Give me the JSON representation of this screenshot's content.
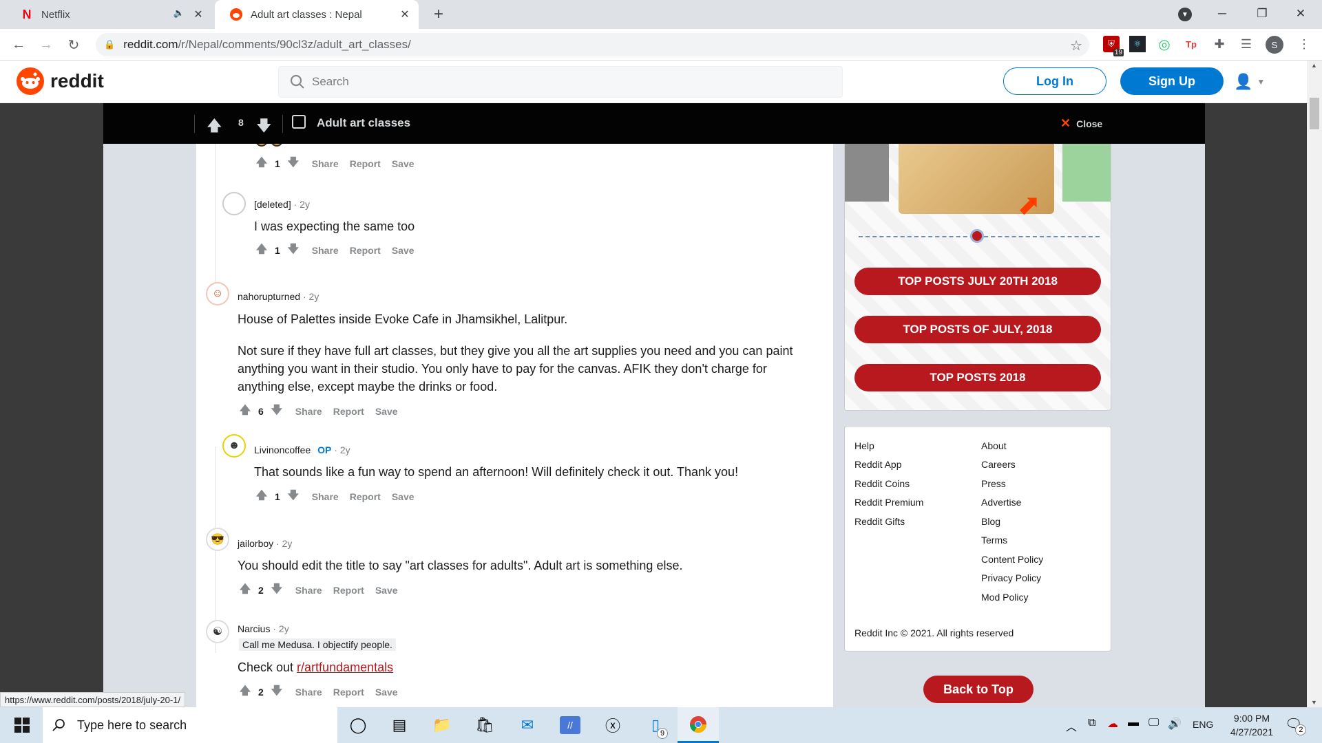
{
  "browser": {
    "tabs": [
      {
        "title": "Netflix",
        "audio_icon": "speaker-icon"
      },
      {
        "title": "Adult art classes : Nepal",
        "active": true
      }
    ],
    "url_domain": "reddit.com",
    "url_path": "/r/Nepal/comments/90cl3z/adult_art_classes/",
    "extension_badge": "19",
    "profile_initial": "S"
  },
  "reddit": {
    "brand": "reddit",
    "search_placeholder": "Search",
    "login_label": "Log In",
    "signup_label": "Sign Up",
    "accent": "#0079d3"
  },
  "postbar": {
    "votes": "8",
    "title": "Adult art classes",
    "close_label": "Close"
  },
  "comments": [
    {
      "score": "1",
      "actions": [
        "Share",
        "Report",
        "Save"
      ]
    },
    {
      "author": "[deleted]",
      "age": "2y",
      "body": "I was expecting the same too",
      "score": "1"
    },
    {
      "author": "nahorupturned",
      "age": "2y",
      "body": [
        "House of Palettes inside Evoke Cafe in Jhamsikhel, Lalitpur.",
        "Not sure if they have full art classes, but they give you all the art supplies you need and you can paint anything you want in their studio. You only have to pay for the canvas. AFIK they don't charge for anything else, except maybe the drinks or food."
      ],
      "score": "6"
    },
    {
      "author": "Livinoncoffee",
      "op_label": "OP",
      "age": "2y",
      "body": "That sounds like a fun way to spend an afternoon! Will definitely check it out. Thank you!",
      "score": "1"
    },
    {
      "author": "jailorboy",
      "age": "2y",
      "body": "You should edit the title to say \"art classes for adults\". Adult art is something else.",
      "score": "2"
    },
    {
      "author": "Narcius",
      "age": "2y",
      "flair": "Call me Medusa. I objectify people.",
      "body_prefix": "Check out ",
      "body_link": "r/artfundamentals",
      "score": "2"
    }
  ],
  "action_labels": {
    "share": "Share",
    "report": "Report",
    "save": "Save"
  },
  "sidebar": {
    "buttons": [
      "TOP POSTS JULY 20TH 2018",
      "TOP POSTS OF JULY, 2018",
      "TOP POSTS 2018"
    ],
    "footer_left": [
      "Help",
      "Reddit App",
      "Reddit Coins",
      "Reddit Premium",
      "Reddit Gifts"
    ],
    "footer_right": [
      "About",
      "Careers",
      "Press",
      "Advertise",
      "Blog",
      "Terms",
      "Content Policy",
      "Privacy Policy",
      "Mod Policy"
    ],
    "copyright": "Reddit Inc © 2021. All rights reserved",
    "back_to_top": "Back to Top",
    "brand_color": "#b7191e"
  },
  "status_url": "https://www.reddit.com/posts/2018/july-20-1/",
  "taskbar": {
    "search_placeholder": "Type here to search",
    "language": "ENG",
    "time": "9:00 PM",
    "date": "4/27/2021",
    "notification_count": "2",
    "app_badge": "9"
  }
}
